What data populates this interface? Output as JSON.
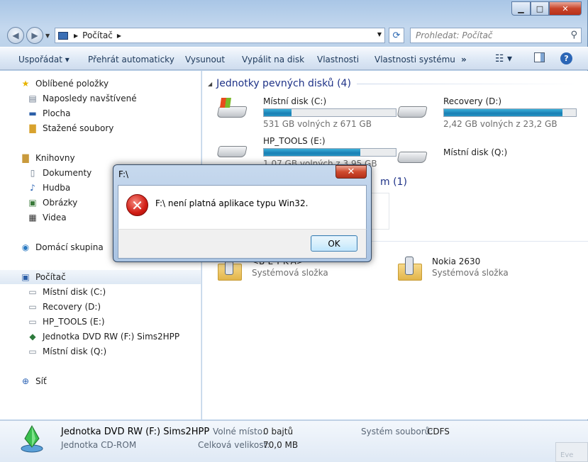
{
  "window": {
    "caption_buttons": {
      "minimize": "▁",
      "maximize": "□",
      "close": "✕"
    }
  },
  "navigation": {
    "back": "◀",
    "forward": "▶",
    "address": {
      "location": "Počítač",
      "separator_1": "▶",
      "separator_2": "▶"
    },
    "search_placeholder": "Prohledat: Počítač"
  },
  "toolbar": {
    "organize": "Uspořádat ▾",
    "autoplay": "Přehrát automaticky",
    "eject": "Vysunout",
    "burn": "Vypálit na disk",
    "properties": "Vlastnosti",
    "system_properties": "Vlastnosti systému",
    "more": "»",
    "help": "?"
  },
  "sidebar": {
    "favorites": "Oblíbené položky",
    "recent": "Naposledy navštívené",
    "desktop": "Plocha",
    "downloads": "Stažené soubory",
    "libraries": "Knihovny",
    "documents": "Dokumenty",
    "music": "Hudba",
    "pictures": "Obrázky",
    "videos": "Videa",
    "homegroup": "Domácí skupina",
    "computer": "Počítač",
    "drive_c": "Místní disk (C:)",
    "drive_d": "Recovery (D:)",
    "drive_e": "HP_TOOLS (E:)",
    "drive_f": "Jednotka DVD RW (F:) Sims2HPP",
    "drive_q": "Místní disk (Q:)",
    "network": "Síť"
  },
  "content": {
    "group_hdd": "Jednotky pevných disků (4)",
    "group2_count_visible": "m (1)",
    "drives": [
      {
        "name": "Místní disk (C:)",
        "free_text": "531 GB volných z 671 GB",
        "used_fraction": 0.21
      },
      {
        "name": "Recovery (D:)",
        "free_text": "2,42 GB volných z 23,2 GB",
        "used_fraction": 0.9
      },
      {
        "name": "HP_TOOLS (E:)",
        "free_text": "1,07 GB volných z 3,95 GB",
        "used_fraction": 0.73
      },
      {
        "name": "Místní disk (Q:)"
      }
    ],
    "devices": [
      {
        "name": "<B-E-T-K-A>",
        "sub": "Systémová složka"
      },
      {
        "name": "Nokia 2630",
        "sub": "Systémová složka"
      }
    ]
  },
  "details": {
    "title": "Jednotka DVD RW (F:) Sims2HPP",
    "type": "Jednotka CD-ROM",
    "free_label": "Volné místo:",
    "free_value": "0 bajtů",
    "total_label": "Celková velikost:",
    "total_value": "70,0 MB",
    "fs_label": "Systém souborů:",
    "fs_value": "CDFS",
    "watermark": "Eve"
  },
  "dialog": {
    "title": "F:\\",
    "close": "✕",
    "error_icon": "✕",
    "message": "F:\\ není platná aplikace typu Win32.",
    "ok": "OK"
  }
}
